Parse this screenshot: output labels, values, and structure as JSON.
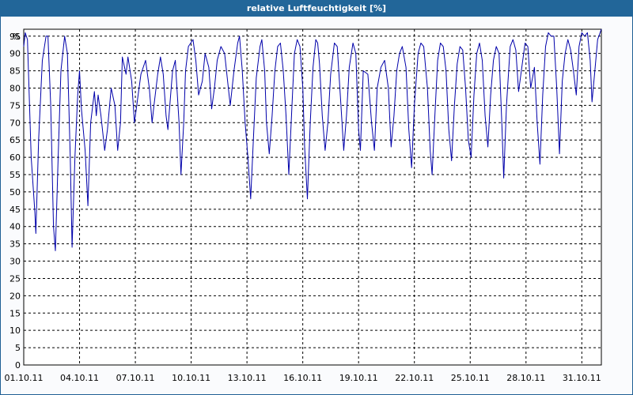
{
  "window": {
    "title": "relative Luftfeuchtigkeit [%]"
  },
  "colors": {
    "titlebar": "#226699",
    "series": "#0000aa",
    "grid": "#000000",
    "background": "#ffffff"
  },
  "chart_data": {
    "type": "line",
    "title": "relative Luftfeuchtigkeit [%]",
    "xlabel": "",
    "ylabel": "%",
    "ylim": [
      0,
      97
    ],
    "grid": true,
    "legend": "none",
    "x_unit": "day of October 2011 (hourly)",
    "xlim": [
      1,
      32.05
    ],
    "x_tick_values": [
      1,
      4,
      7,
      10,
      13,
      16,
      19,
      22,
      25,
      28,
      31
    ],
    "x_tick_labels": [
      "01.10.11",
      "04.10.11",
      "07.10.11",
      "10.10.11",
      "13.10.11",
      "16.10.11",
      "19.10.11",
      "22.10.11",
      "25.10.11",
      "28.10.11",
      "31.10.11"
    ],
    "y_ticks": [
      0,
      5,
      10,
      15,
      20,
      25,
      30,
      35,
      40,
      45,
      50,
      55,
      60,
      65,
      70,
      75,
      80,
      85,
      90,
      95
    ],
    "y_unit_label": "%",
    "series": [
      {
        "key_points": [
          [
            1.0,
            92
          ],
          [
            1.08,
            96
          ],
          [
            1.2,
            94
          ],
          [
            1.4,
            60
          ],
          [
            1.6,
            44
          ],
          [
            1.65,
            38
          ],
          [
            1.8,
            65
          ],
          [
            2.0,
            88
          ],
          [
            2.2,
            95
          ],
          [
            2.3,
            95
          ],
          [
            2.45,
            75
          ],
          [
            2.6,
            40
          ],
          [
            2.7,
            33
          ],
          [
            2.85,
            60
          ],
          [
            3.0,
            85
          ],
          [
            3.2,
            95
          ],
          [
            3.35,
            90
          ],
          [
            3.5,
            60
          ],
          [
            3.6,
            34
          ],
          [
            3.75,
            60
          ],
          [
            3.9,
            78
          ],
          [
            4.0,
            85
          ],
          [
            4.1,
            74
          ],
          [
            4.3,
            62
          ],
          [
            4.45,
            46
          ],
          [
            4.6,
            70
          ],
          [
            4.8,
            79
          ],
          [
            4.9,
            72
          ],
          [
            5.0,
            78
          ],
          [
            5.15,
            72
          ],
          [
            5.35,
            62
          ],
          [
            5.5,
            68
          ],
          [
            5.7,
            80
          ],
          [
            5.9,
            75
          ],
          [
            6.05,
            62
          ],
          [
            6.2,
            70
          ],
          [
            6.3,
            89
          ],
          [
            6.5,
            84
          ],
          [
            6.6,
            89
          ],
          [
            6.8,
            82
          ],
          [
            6.95,
            70
          ],
          [
            7.1,
            76
          ],
          [
            7.3,
            84
          ],
          [
            7.55,
            88
          ],
          [
            7.75,
            80
          ],
          [
            7.9,
            70
          ],
          [
            8.0,
            75
          ],
          [
            8.2,
            84
          ],
          [
            8.35,
            89
          ],
          [
            8.5,
            84
          ],
          [
            8.65,
            72
          ],
          [
            8.75,
            68
          ],
          [
            8.85,
            75
          ],
          [
            9.0,
            85
          ],
          [
            9.15,
            88
          ],
          [
            9.2,
            83
          ],
          [
            9.35,
            70
          ],
          [
            9.45,
            55
          ],
          [
            9.6,
            70
          ],
          [
            9.7,
            85
          ],
          [
            9.85,
            92
          ],
          [
            10.1,
            94
          ],
          [
            10.25,
            88
          ],
          [
            10.4,
            78
          ],
          [
            10.6,
            82
          ],
          [
            10.75,
            90
          ],
          [
            10.95,
            86
          ],
          [
            11.1,
            74
          ],
          [
            11.25,
            80
          ],
          [
            11.4,
            88
          ],
          [
            11.6,
            92
          ],
          [
            11.8,
            90
          ],
          [
            12.0,
            80
          ],
          [
            12.1,
            75
          ],
          [
            12.3,
            85
          ],
          [
            12.5,
            93
          ],
          [
            12.6,
            95
          ],
          [
            12.75,
            85
          ],
          [
            12.9,
            70
          ],
          [
            13.05,
            60
          ],
          [
            13.2,
            48
          ],
          [
            13.35,
            66
          ],
          [
            13.5,
            83
          ],
          [
            13.7,
            92
          ],
          [
            13.8,
            94
          ],
          [
            13.95,
            85
          ],
          [
            14.05,
            70
          ],
          [
            14.2,
            61
          ],
          [
            14.35,
            72
          ],
          [
            14.5,
            85
          ],
          [
            14.65,
            92
          ],
          [
            14.8,
            93
          ],
          [
            14.95,
            85
          ],
          [
            15.1,
            72
          ],
          [
            15.25,
            55
          ],
          [
            15.4,
            73
          ],
          [
            15.55,
            90
          ],
          [
            15.7,
            94
          ],
          [
            15.85,
            92
          ],
          [
            16.0,
            80
          ],
          [
            16.1,
            63
          ],
          [
            16.25,
            48
          ],
          [
            16.4,
            70
          ],
          [
            16.55,
            86
          ],
          [
            16.7,
            94
          ],
          [
            16.8,
            93
          ],
          [
            16.9,
            87
          ],
          [
            17.05,
            72
          ],
          [
            17.2,
            62
          ],
          [
            17.35,
            70
          ],
          [
            17.5,
            84
          ],
          [
            17.7,
            93
          ],
          [
            17.85,
            92
          ],
          [
            18.05,
            75
          ],
          [
            18.2,
            62
          ],
          [
            18.35,
            72
          ],
          [
            18.5,
            86
          ],
          [
            18.7,
            93
          ],
          [
            18.85,
            90
          ],
          [
            19.0,
            68
          ],
          [
            19.1,
            62
          ],
          [
            19.25,
            85
          ],
          [
            19.5,
            84
          ],
          [
            19.7,
            70
          ],
          [
            19.85,
            62
          ],
          [
            20.0,
            80
          ],
          [
            20.2,
            86
          ],
          [
            20.4,
            88
          ],
          [
            20.6,
            80
          ],
          [
            20.75,
            63
          ],
          [
            20.9,
            72
          ],
          [
            21.05,
            85
          ],
          [
            21.2,
            90
          ],
          [
            21.35,
            92
          ],
          [
            21.55,
            86
          ],
          [
            21.7,
            68
          ],
          [
            21.85,
            57
          ],
          [
            22.0,
            75
          ],
          [
            22.2,
            90
          ],
          [
            22.35,
            93
          ],
          [
            22.5,
            92
          ],
          [
            22.7,
            80
          ],
          [
            22.85,
            62
          ],
          [
            22.95,
            55
          ],
          [
            23.1,
            72
          ],
          [
            23.25,
            88
          ],
          [
            23.4,
            93
          ],
          [
            23.55,
            92
          ],
          [
            23.7,
            85
          ],
          [
            23.85,
            68
          ],
          [
            24.0,
            59
          ],
          [
            24.15,
            75
          ],
          [
            24.3,
            87
          ],
          [
            24.45,
            92
          ],
          [
            24.6,
            91
          ],
          [
            24.75,
            80
          ],
          [
            24.9,
            65
          ],
          [
            25.05,
            60
          ],
          [
            25.2,
            78
          ],
          [
            25.35,
            90
          ],
          [
            25.5,
            93
          ],
          [
            25.65,
            88
          ],
          [
            25.8,
            72
          ],
          [
            25.95,
            63
          ],
          [
            26.1,
            78
          ],
          [
            26.25,
            88
          ],
          [
            26.4,
            92
          ],
          [
            26.55,
            90
          ],
          [
            26.7,
            70
          ],
          [
            26.8,
            54
          ],
          [
            26.95,
            75
          ],
          [
            27.15,
            92
          ],
          [
            27.3,
            94
          ],
          [
            27.45,
            91
          ],
          [
            27.6,
            79
          ],
          [
            27.75,
            85
          ],
          [
            27.95,
            93
          ],
          [
            28.1,
            92
          ],
          [
            28.25,
            80
          ],
          [
            28.45,
            86
          ],
          [
            28.6,
            70
          ],
          [
            28.75,
            58
          ],
          [
            28.9,
            78
          ],
          [
            29.05,
            92
          ],
          [
            29.2,
            96
          ],
          [
            29.35,
            95
          ],
          [
            29.5,
            95
          ],
          [
            29.65,
            80
          ],
          [
            29.8,
            61
          ],
          [
            29.95,
            82
          ],
          [
            30.1,
            90
          ],
          [
            30.25,
            94
          ],
          [
            30.4,
            91
          ],
          [
            30.55,
            85
          ],
          [
            30.7,
            78
          ],
          [
            30.85,
            92
          ],
          [
            31.0,
            96
          ],
          [
            31.15,
            95
          ],
          [
            31.3,
            96
          ],
          [
            31.45,
            88
          ],
          [
            31.55,
            76
          ],
          [
            31.7,
            85
          ],
          [
            31.85,
            94
          ],
          [
            32.05,
            97
          ]
        ]
      }
    ]
  }
}
